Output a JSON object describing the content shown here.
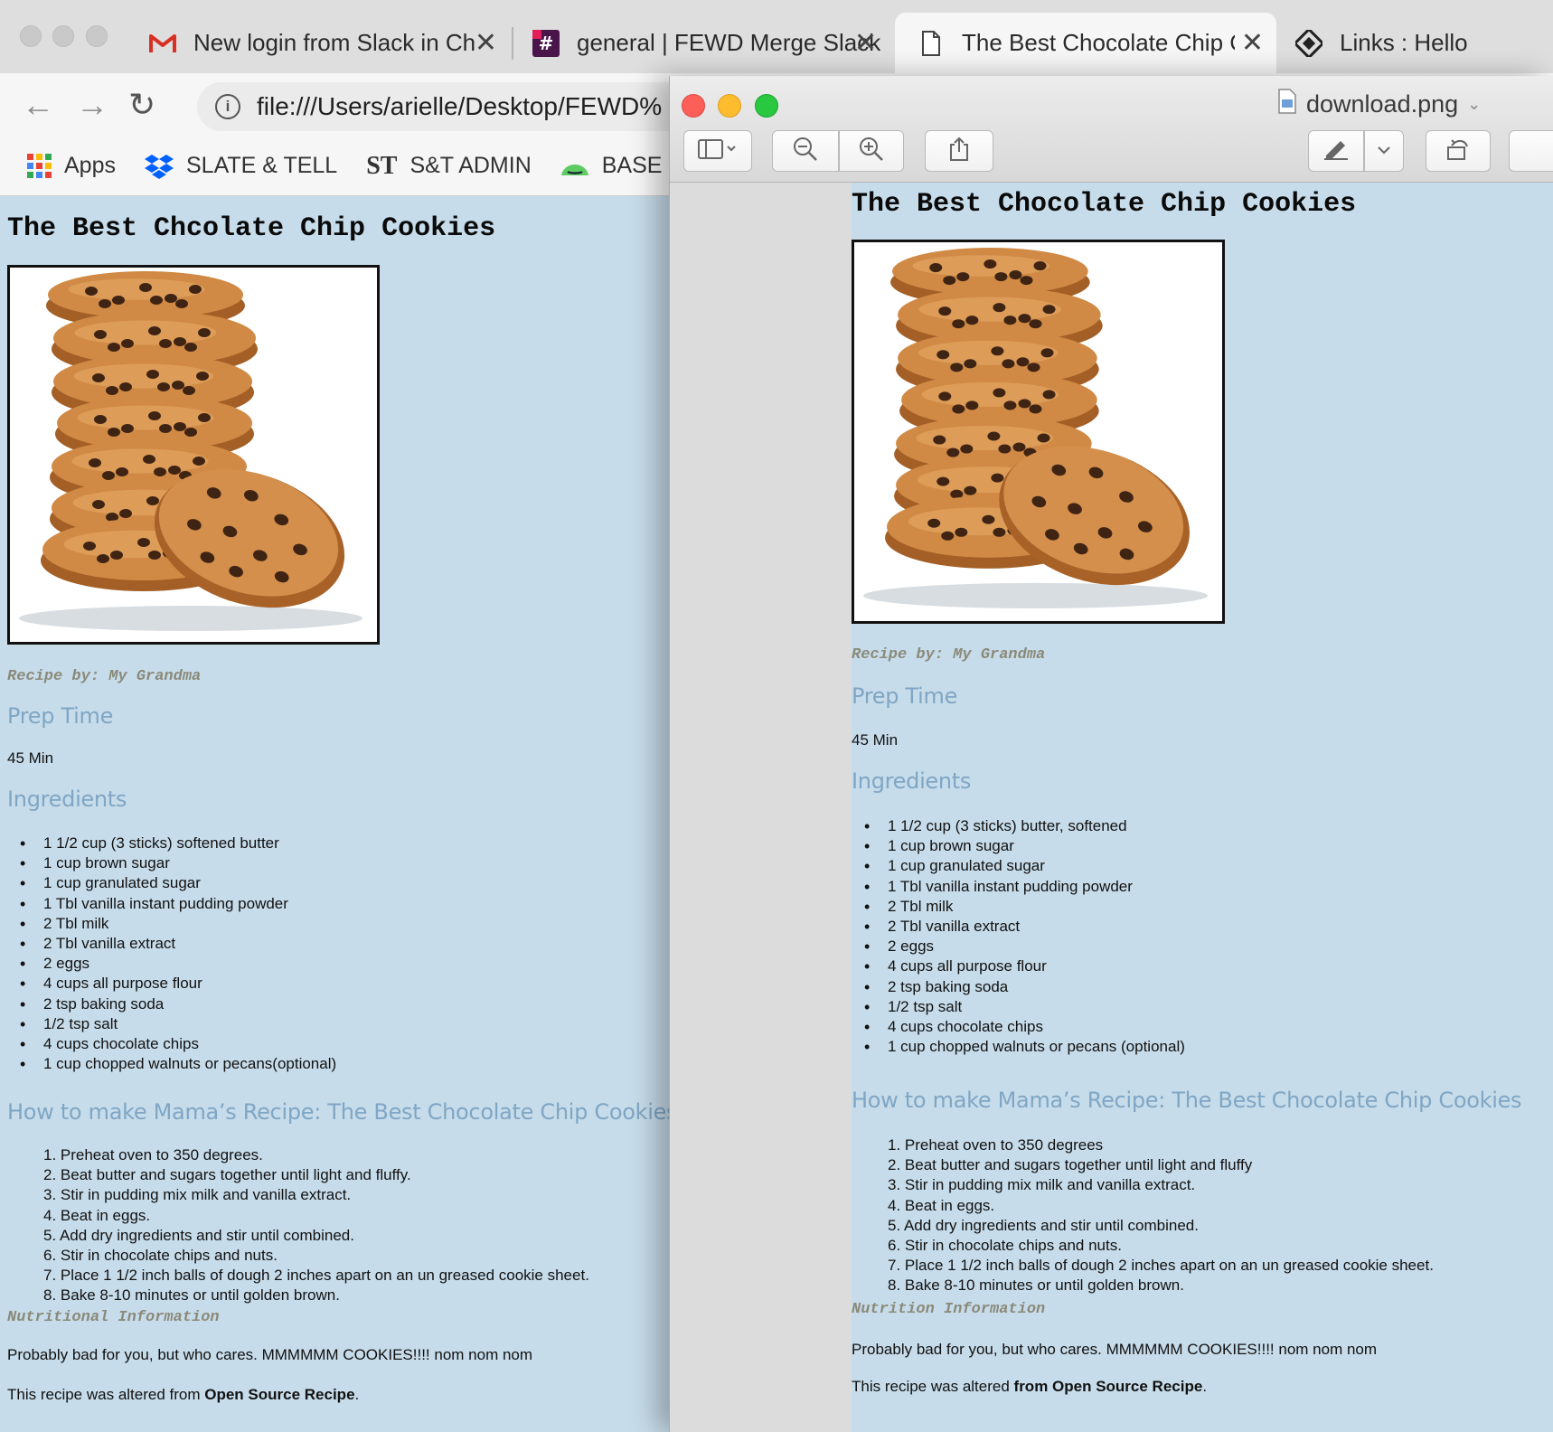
{
  "chrome": {
    "tabs": [
      {
        "title": "New login from Slack in Chrome",
        "icon": "gmail-icon"
      },
      {
        "title": "general | FEWD Merge Slack",
        "icon": "slack-icon"
      },
      {
        "title": "The Best Chocolate Chip Cookies",
        "icon": "file-icon"
      },
      {
        "title": "Links : Hello",
        "icon": "links-icon"
      }
    ],
    "address": "file:///Users/arielle/Desktop/FEWD%",
    "bookmarks": [
      {
        "label": "Apps",
        "icon": "apps-grid-icon"
      },
      {
        "label": "SLATE & TELL",
        "icon": "dropbox-icon"
      },
      {
        "label": "S&T ADMIN",
        "icon": "st-logo-icon",
        "icon_text": "ST"
      },
      {
        "label": "BASE CAMP",
        "icon": "basecamp-icon"
      }
    ]
  },
  "browser_page": {
    "title": "The Best Chcolate Chip Cookies",
    "byline": "Recipe by: My Grandma",
    "prep_heading": "Prep Time",
    "prep_value": "45 Min",
    "ingredients_heading": "Ingredients",
    "ingredients": [
      "1 1/2 cup (3 sticks) softened butter",
      "1 cup brown sugar",
      "1 cup granulated sugar",
      "1 Tbl vanilla instant pudding powder",
      "2 Tbl milk",
      "2 Tbl vanilla extract",
      "2 eggs",
      "4 cups all purpose flour",
      "2 tsp baking soda",
      "1/2 tsp salt",
      "4 cups chocolate chips",
      "1 cup chopped walnuts or pecans(optional)"
    ],
    "steps_heading": "How to make Mama’s Recipe: The Best Chocolate Chip Cookies",
    "steps": [
      "1. Preheat oven to 350 degrees.",
      "2. Beat butter and sugars together until light and fluffy.",
      "3. Stir in pudding mix milk and vanilla extract.",
      "4. Beat in eggs.",
      "5. Add dry ingredients and stir until combined.",
      "6. Stir in chocolate chips and nuts.",
      "7. Place 1 1/2 inch balls of dough 2 inches apart on an un greased cookie sheet.",
      "8. Bake 8-10 minutes or until golden brown."
    ],
    "nutrition_heading": "Nutritional Information",
    "nutrition_text": "Probably bad for you, but who cares. MMMMMM COOKIES!!!! nom nom nom",
    "source_prefix": "This recipe was altered from ",
    "source_bold": "Open Source Recipe",
    "source_suffix": "."
  },
  "preview": {
    "filename": "download.png",
    "image": {
      "title": "The Best Chocolate Chip Cookies",
      "byline": "Recipe by: My Grandma",
      "prep_heading": "Prep Time",
      "prep_value": "45 Min",
      "ingredients_heading": "Ingredients",
      "ingredients": [
        "1 1/2 cup (3 sticks) butter, softened",
        "1 cup brown sugar",
        "1 cup granulated sugar",
        "1 Tbl vanilla instant pudding powder",
        "2 Tbl milk",
        "2 Tbl vanilla extract",
        "2 eggs",
        "4 cups all purpose flour",
        "2 tsp baking soda",
        "1/2 tsp salt",
        "4 cups chocolate chips",
        "1 cup chopped walnuts or pecans (optional)"
      ],
      "steps_heading": "How to make Mama’s Recipe: The Best Chocolate Chip Cookies",
      "steps": [
        "1. Preheat oven to 350 degrees",
        "2. Beat butter and sugars together until light and fluffy",
        "3. Stir in pudding mix milk and vanilla extract.",
        "4. Beat in eggs.",
        "5. Add dry ingredients and stir until combined.",
        "6. Stir in chocolate chips and nuts.",
        "7. Place 1 1/2 inch balls of dough 2 inches apart on an un greased cookie sheet.",
        "8. Bake 8-10 minutes or until golden brown."
      ],
      "nutrition_heading": "Nutrition Information",
      "nutrition_text": "Probably bad for you, but who cares. MMMMMM COOKIES!!!! nom nom nom",
      "source_prefix": "This recipe was altered ",
      "source_bold": "from Open Source Recipe",
      "source_suffix": "."
    }
  },
  "colors": {
    "page_bg": "#c7dcea",
    "heading_blue": "#7fa6c4",
    "byline_gray": "#8a8a7a",
    "close_red": "#fc5f57",
    "minimize_yellow": "#fdbc2e",
    "zoom_green": "#28c840"
  }
}
